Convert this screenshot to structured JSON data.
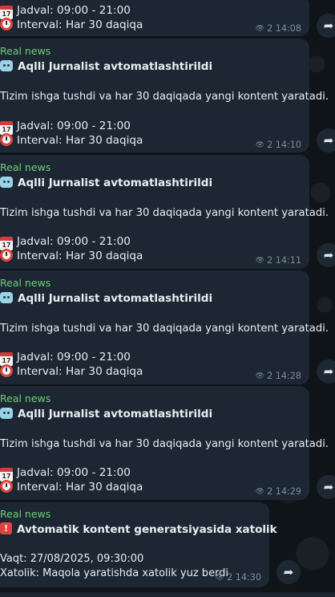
{
  "messages": [
    {
      "sender": "",
      "title_icon": "",
      "title": "",
      "body": "",
      "schedule": "Jadval: 09:00 - 21:00",
      "interval": "Interval: Har 30 daqiqa",
      "views": "2",
      "time": "14:08"
    },
    {
      "sender": "Real news",
      "title_icon": "robot-icon",
      "title": "Aqlli Jurnalist avtomatlashtirildi",
      "body": "Tizim ishga tushdi va har 30 daqiqada yangi kontent yaratadi.",
      "schedule": "Jadval: 09:00 - 21:00",
      "interval": "Interval: Har 30 daqiqa",
      "views": "2",
      "time": "14:10"
    },
    {
      "sender": "Real news",
      "title_icon": "robot-icon",
      "title": "Aqlli Jurnalist avtomatlashtirildi",
      "body": "Tizim ishga tushdi va har 30 daqiqada yangi kontent yaratadi.",
      "schedule": "Jadval: 09:00 - 21:00",
      "interval": "Interval: Har 30 daqiqa",
      "views": "2",
      "time": "14:11"
    },
    {
      "sender": "Real news",
      "title_icon": "robot-icon",
      "title": "Aqlli Jurnalist avtomatlashtirildi",
      "body": "Tizim ishga tushdi va har 30 daqiqada yangi kontent yaratadi.",
      "schedule": "Jadval: 09:00 - 21:00",
      "interval": "Interval: Har 30 daqiqa",
      "views": "2",
      "time": "14:28"
    },
    {
      "sender": "Real news",
      "title_icon": "robot-icon",
      "title": "Aqlli Jurnalist avtomatlashtirildi",
      "body": "Tizim ishga tushdi va har 30 daqiqada yangi kontent yaratadi.",
      "schedule": "Jadval: 09:00 - 21:00",
      "interval": "Interval: Har 30 daqiqa",
      "views": "2",
      "time": "14:29"
    },
    {
      "sender": "Real news",
      "title_icon": "alert-icon",
      "title": "Avtomatik kontent generatsiyasida xatolik",
      "body": "",
      "line1": "Vaqt: 27/08/2025, 09:30:00",
      "line2": "Xatolik: Maqola yaratishda xatolik yuz berdi",
      "views": "2",
      "time": "14:30"
    }
  ],
  "icons": {
    "calendar": "calendar-icon",
    "clock": "alarm-clock-icon",
    "views": "eye-icon",
    "share": "share-icon"
  },
  "colors": {
    "bubble": "#1c2733",
    "sender": "#6fcf75",
    "meta": "#7c8b98"
  }
}
